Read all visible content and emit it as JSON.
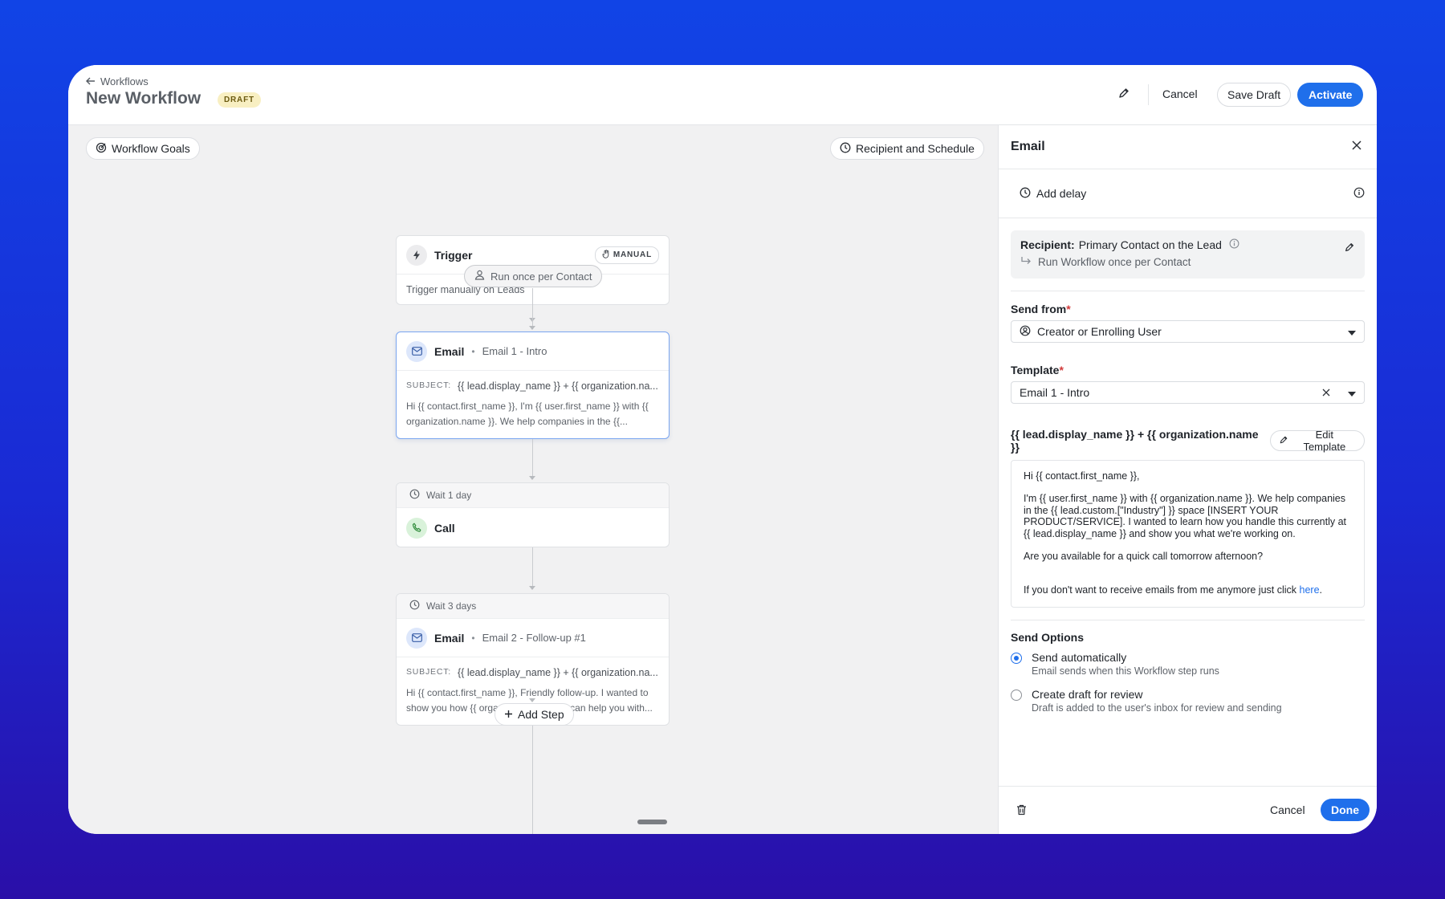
{
  "header": {
    "back_label": "Workflows",
    "title": "New Workflow",
    "status_badge": "DRAFT",
    "cancel_label": "Cancel",
    "save_draft_label": "Save Draft",
    "activate_label": "Activate"
  },
  "canvas": {
    "goals_label": "Workflow Goals",
    "recipient_schedule_label": "Recipient and Schedule",
    "run_once_label": "Run once per Contact",
    "add_step_label": "Add Step",
    "trigger": {
      "title": "Trigger",
      "badge": "MANUAL",
      "description": "Trigger manually on Leads"
    },
    "steps": [
      {
        "type": "Email",
        "name": "Email 1 - Intro",
        "subject_label": "SUBJECT:",
        "subject": "{{ lead.display_name }} + {{ organization.na...",
        "preview": "Hi {{ contact.first_name }}, I'm {{ user.first_name }} with {{ organization.name }}. We help companies in the {{..."
      },
      {
        "wait": "Wait 1 day",
        "type": "Call"
      },
      {
        "wait": "Wait 3 days",
        "type": "Email",
        "name": "Email 2 - Follow-up #1",
        "subject_label": "SUBJECT:",
        "subject": "{{ lead.display_name }} + {{ organization.na...",
        "preview": "Hi {{ contact.first_name }}, Friendly follow-up. I wanted to show you how {{ organization.name }} can help you with..."
      }
    ]
  },
  "panel": {
    "title": "Email",
    "add_delay_label": "Add delay",
    "recipient_label": "Recipient:",
    "recipient_value": "Primary Contact on the Lead",
    "run_once_text": "Run Workflow once per Contact",
    "send_from_label": "Send from",
    "send_from_value": "Creator or Enrolling User",
    "template_label": "Template",
    "template_value": "Email 1 - Intro",
    "subject": "{{ lead.display_name }} + {{ organization.name }}",
    "edit_template_label": "Edit Template",
    "body": {
      "greeting": "Hi {{ contact.first_name }},",
      "paragraph": "I'm {{ user.first_name }} with {{ organization.name }}. We help companies in the {{ lead.custom.[\"Industry\"] }} space [INSERT YOUR PRODUCT/SERVICE]. I wanted to learn how you handle this currently at {{ lead.display_name }} and show you what we're working on.",
      "question": "Are you available for a quick call tomorrow afternoon?",
      "unsubscribe_text": "If you don't want to receive emails from me anymore just click ",
      "unsubscribe_link": "here",
      "unsubscribe_end": "."
    },
    "send_options_label": "Send Options",
    "options": [
      {
        "title": "Send automatically",
        "description": "Email sends when this Workflow step runs",
        "selected": true
      },
      {
        "title": "Create draft for review",
        "description": "Draft is added to the user's inbox for review and sending",
        "selected": false
      }
    ],
    "cancel_label": "Cancel",
    "done_label": "Done"
  },
  "colors": {
    "accent": "#1f6feb",
    "draft_badge_bg": "#f8efc2",
    "background_gradient_top": "#1144e6",
    "background_gradient_bottom": "#2a0fa8"
  }
}
